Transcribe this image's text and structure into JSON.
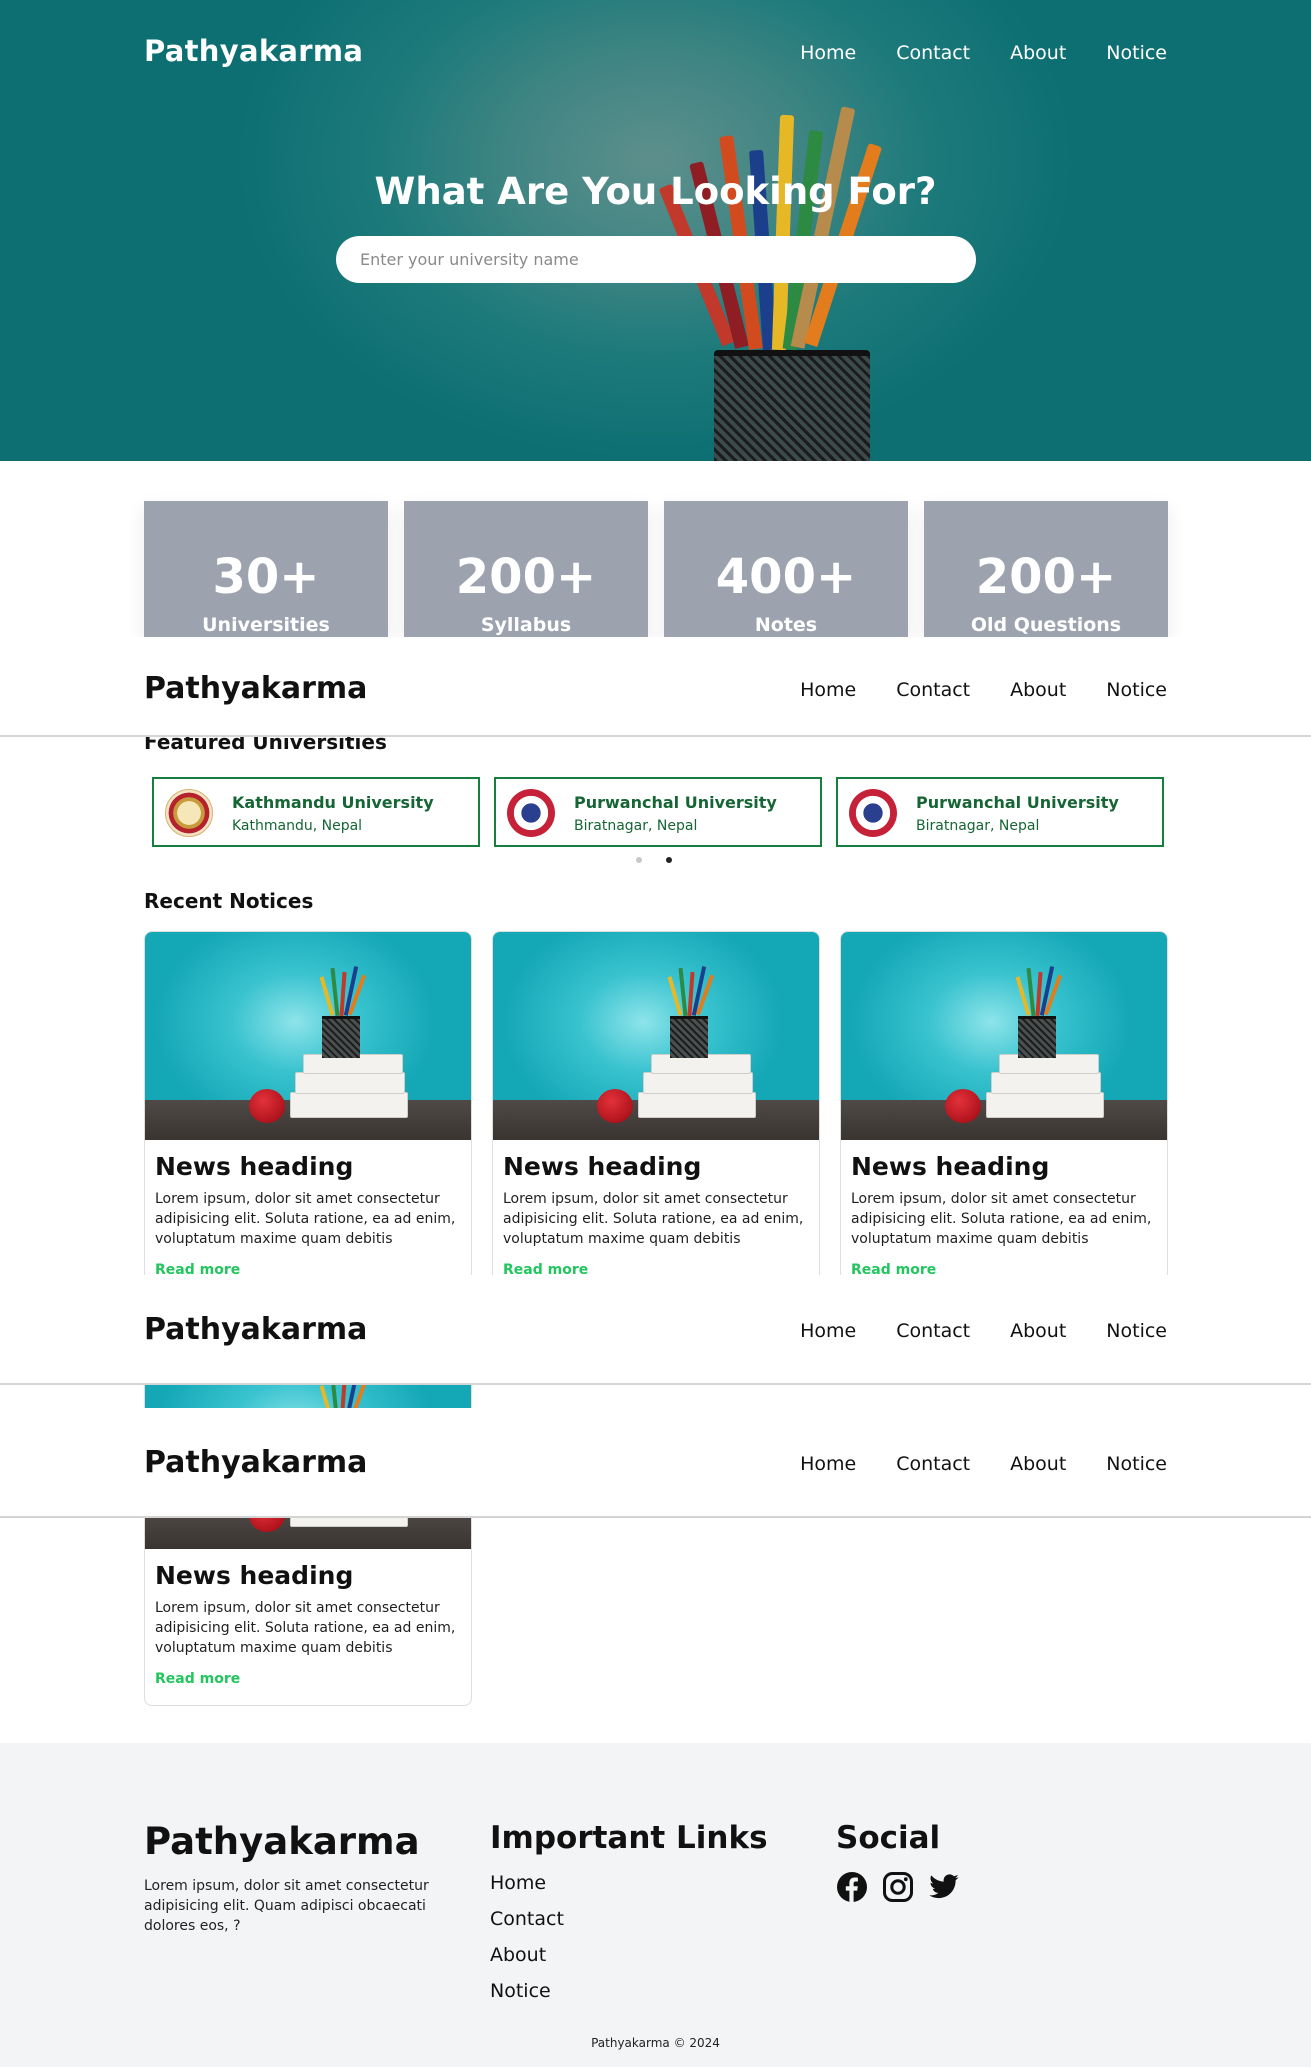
{
  "site": {
    "name": "Pathyakarma"
  },
  "nav": {
    "items": [
      "Home",
      "Contact",
      "About",
      "Notice"
    ]
  },
  "hero": {
    "headline": "What Are You Looking For?",
    "search_placeholder": "Enter your university name",
    "search_value": ""
  },
  "stats": [
    {
      "value": "30+",
      "label": "Universities"
    },
    {
      "value": "200+",
      "label": "Syllabus"
    },
    {
      "value": "400+",
      "label": "Notes"
    },
    {
      "value": "200+",
      "label": "Old Questions"
    }
  ],
  "featured": {
    "title": "Featured Universities",
    "universities": [
      {
        "name": "Kathmandu University",
        "location": "Kathmandu, Nepal",
        "icon": "university-seal-icon"
      },
      {
        "name": "Purwanchal University",
        "location": "Biratnagar, Nepal",
        "icon": "university-star-emblem-icon"
      },
      {
        "name": "Purwanchal University",
        "location": "Biratnagar, Nepal",
        "icon": "university-star-emblem-icon"
      }
    ],
    "carousel_pages": 2,
    "active_page": 2
  },
  "notices": {
    "title": "Recent Notices",
    "cards": [
      {
        "heading": "News heading",
        "body": "Lorem ipsum, dolor sit amet consectetur adipisicing elit. Soluta ratione, ea ad enim, voluptatum maxime quam debitis voluptatem.",
        "link": "Read more"
      },
      {
        "heading": "News heading",
        "body": "Lorem ipsum, dolor sit amet consectetur adipisicing elit. Soluta ratione, ea ad enim, voluptatum maxime quam debitis voluptatem.",
        "link": "Read more"
      },
      {
        "heading": "News heading",
        "body": "Lorem ipsum, dolor sit amet consectetur adipisicing elit. Soluta ratione, ea ad enim, voluptatum maxime quam debitis voluptatem.",
        "link": "Read more"
      },
      {
        "heading": "News heading",
        "body": "Lorem ipsum, dolor sit amet consectetur adipisicing elit. Soluta ratione, ea ad enim, voluptatum maxime quam debitis voluptatem.",
        "link": "Read more"
      }
    ]
  },
  "footer": {
    "logo": "Pathyakarma",
    "description": "Lorem ipsum, dolor sit amet consectetur adipisicing elit. Quam adipisci obcaecati dolores eos, ?",
    "links_title": "Important Links",
    "links": [
      "Home",
      "Contact",
      "About",
      "Notice"
    ],
    "social_title": "Social",
    "social": [
      "facebook-icon",
      "instagram-icon",
      "twitter-icon"
    ],
    "copyright": "Pathyakarma © 2024"
  },
  "colors": {
    "hero_teal": "#1d7a7b",
    "stat_card": "#9ca3af",
    "uni_border": "#15803d",
    "read_more": "#22c55e",
    "footer_bg": "#f3f4f6"
  }
}
